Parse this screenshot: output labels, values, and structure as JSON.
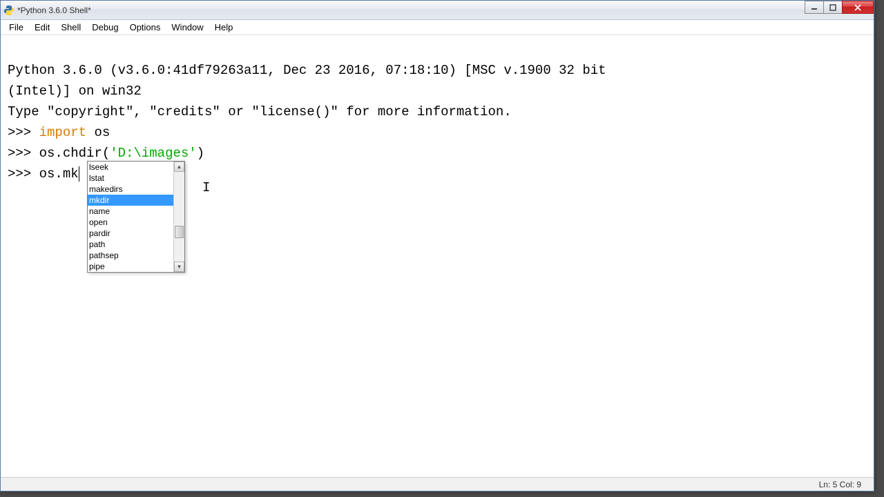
{
  "window": {
    "title": "*Python 3.6.0 Shell*"
  },
  "menu": {
    "items": [
      "File",
      "Edit",
      "Shell",
      "Debug",
      "Options",
      "Window",
      "Help"
    ]
  },
  "shell": {
    "banner1": "Python 3.6.0 (v3.6.0:41df79263a11, Dec 23 2016, 07:18:10) [MSC v.1900 32 bit",
    "banner2": "(Intel)] on win32",
    "banner3": "Type \"copyright\", \"credits\" or \"license()\" for more information.",
    "prompt": ">>>",
    "line1_kw": "import",
    "line1_rest": " os",
    "line2_pre": "os.chdir(",
    "line2_str": "'D:\\images'",
    "line2_post": ")",
    "line3": "os.mk"
  },
  "autocomplete": {
    "items": [
      "lseek",
      "lstat",
      "makedirs",
      "mkdir",
      "name",
      "open",
      "pardir",
      "path",
      "pathsep",
      "pipe"
    ],
    "selected_index": 3
  },
  "status": {
    "text": "Ln: 5  Col: 9"
  }
}
